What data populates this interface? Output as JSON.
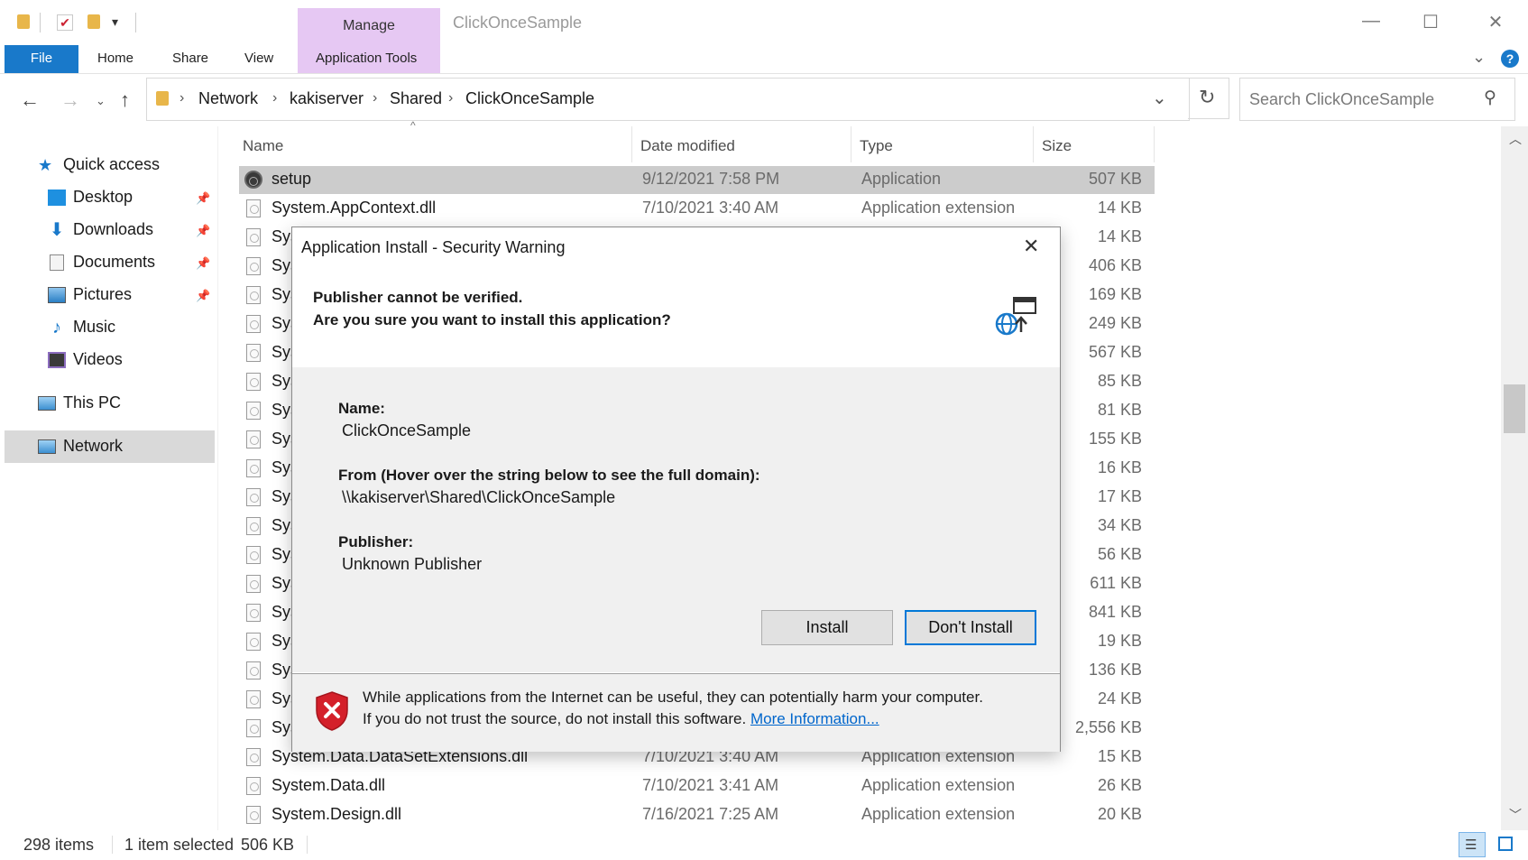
{
  "window": {
    "title": "ClickOnceSample",
    "minimize": "—",
    "maximize": "☐",
    "close": "✕"
  },
  "ribbon": {
    "manage_label": "Manage",
    "tabs": [
      "File",
      "Home",
      "Share",
      "View",
      "Application Tools"
    ]
  },
  "address": {
    "crumbs": [
      "Network",
      "kakiserver",
      "Shared",
      "ClickOnceSample"
    ],
    "search_placeholder": "Search ClickOnceSample"
  },
  "nav": {
    "quick_access": "Quick access",
    "items": [
      "Desktop",
      "Downloads",
      "Documents",
      "Pictures",
      "Music",
      "Videos"
    ],
    "this_pc": "This PC",
    "network": "Network"
  },
  "columns": {
    "name": "Name",
    "date": "Date modified",
    "type": "Type",
    "size": "Size"
  },
  "files": [
    {
      "name": "setup",
      "date": "9/12/2021 7:58 PM",
      "type": "Application",
      "size": "507 KB"
    },
    {
      "name": "System.AppContext.dll",
      "date": "7/10/2021 3:40 AM",
      "type": "Application extension",
      "size": "14 KB"
    },
    {
      "name": "Sys",
      "date": "",
      "type": "",
      "size": "14 KB"
    },
    {
      "name": "Sys",
      "date": "",
      "type": "",
      "size": "406 KB"
    },
    {
      "name": "Sys",
      "date": "",
      "type": "",
      "size": "169 KB"
    },
    {
      "name": "Sys",
      "date": "",
      "type": "",
      "size": "249 KB"
    },
    {
      "name": "Sys",
      "date": "",
      "type": "",
      "size": "567 KB"
    },
    {
      "name": "Sys",
      "date": "",
      "type": "",
      "size": "85 KB"
    },
    {
      "name": "Sys",
      "date": "",
      "type": "",
      "size": "81 KB"
    },
    {
      "name": "Sys",
      "date": "",
      "type": "",
      "size": "155 KB"
    },
    {
      "name": "Sys",
      "date": "",
      "type": "",
      "size": "16 KB"
    },
    {
      "name": "Sys",
      "date": "",
      "type": "",
      "size": "17 KB"
    },
    {
      "name": "Sys",
      "date": "",
      "type": "",
      "size": "34 KB"
    },
    {
      "name": "Sys",
      "date": "",
      "type": "",
      "size": "56 KB"
    },
    {
      "name": "Sys",
      "date": "",
      "type": "",
      "size": "611 KB"
    },
    {
      "name": "Sys",
      "date": "",
      "type": "",
      "size": "841 KB"
    },
    {
      "name": "Sys",
      "date": "",
      "type": "",
      "size": "19 KB"
    },
    {
      "name": "Sys",
      "date": "",
      "type": "",
      "size": "136 KB"
    },
    {
      "name": "Sys",
      "date": "",
      "type": "",
      "size": "24 KB"
    },
    {
      "name": "Sys",
      "date": "",
      "type": "",
      "size": "2,556 KB"
    },
    {
      "name": "System.Data.DataSetExtensions.dll",
      "date": "7/10/2021 3:40 AM",
      "type": "Application extension",
      "size": "15 KB"
    },
    {
      "name": "System.Data.dll",
      "date": "7/10/2021 3:41 AM",
      "type": "Application extension",
      "size": "26 KB"
    },
    {
      "name": "System.Design.dll",
      "date": "7/16/2021 7:25 AM",
      "type": "Application extension",
      "size": "20 KB"
    }
  ],
  "status": {
    "items": "298 items",
    "selected": "1 item selected",
    "size": "506 KB"
  },
  "dialog": {
    "title": "Application Install - Security Warning",
    "heading1": "Publisher cannot be verified.",
    "heading2": "Are you sure you want to install this application?",
    "name_label": "Name:",
    "name_value": "ClickOnceSample",
    "from_label": "From (Hover over the string below to see the full domain):",
    "from_value": "\\\\kakiserver\\Shared\\ClickOnceSample",
    "publisher_label": "Publisher:",
    "publisher_value": "Unknown Publisher",
    "install_button": "Install",
    "dont_install_button": "Don't Install",
    "warning_line1": "While applications from the Internet can be useful, they can potentially harm your computer.",
    "warning_line2": "If you do not trust the source, do not install this software.",
    "more_info_link": "More Information..."
  },
  "colors": {
    "accent": "#0078d7",
    "manage_band": "#e6c8f3",
    "selected_row": "#cccccc",
    "link": "#0066cc",
    "shield_red": "#d4202a"
  }
}
